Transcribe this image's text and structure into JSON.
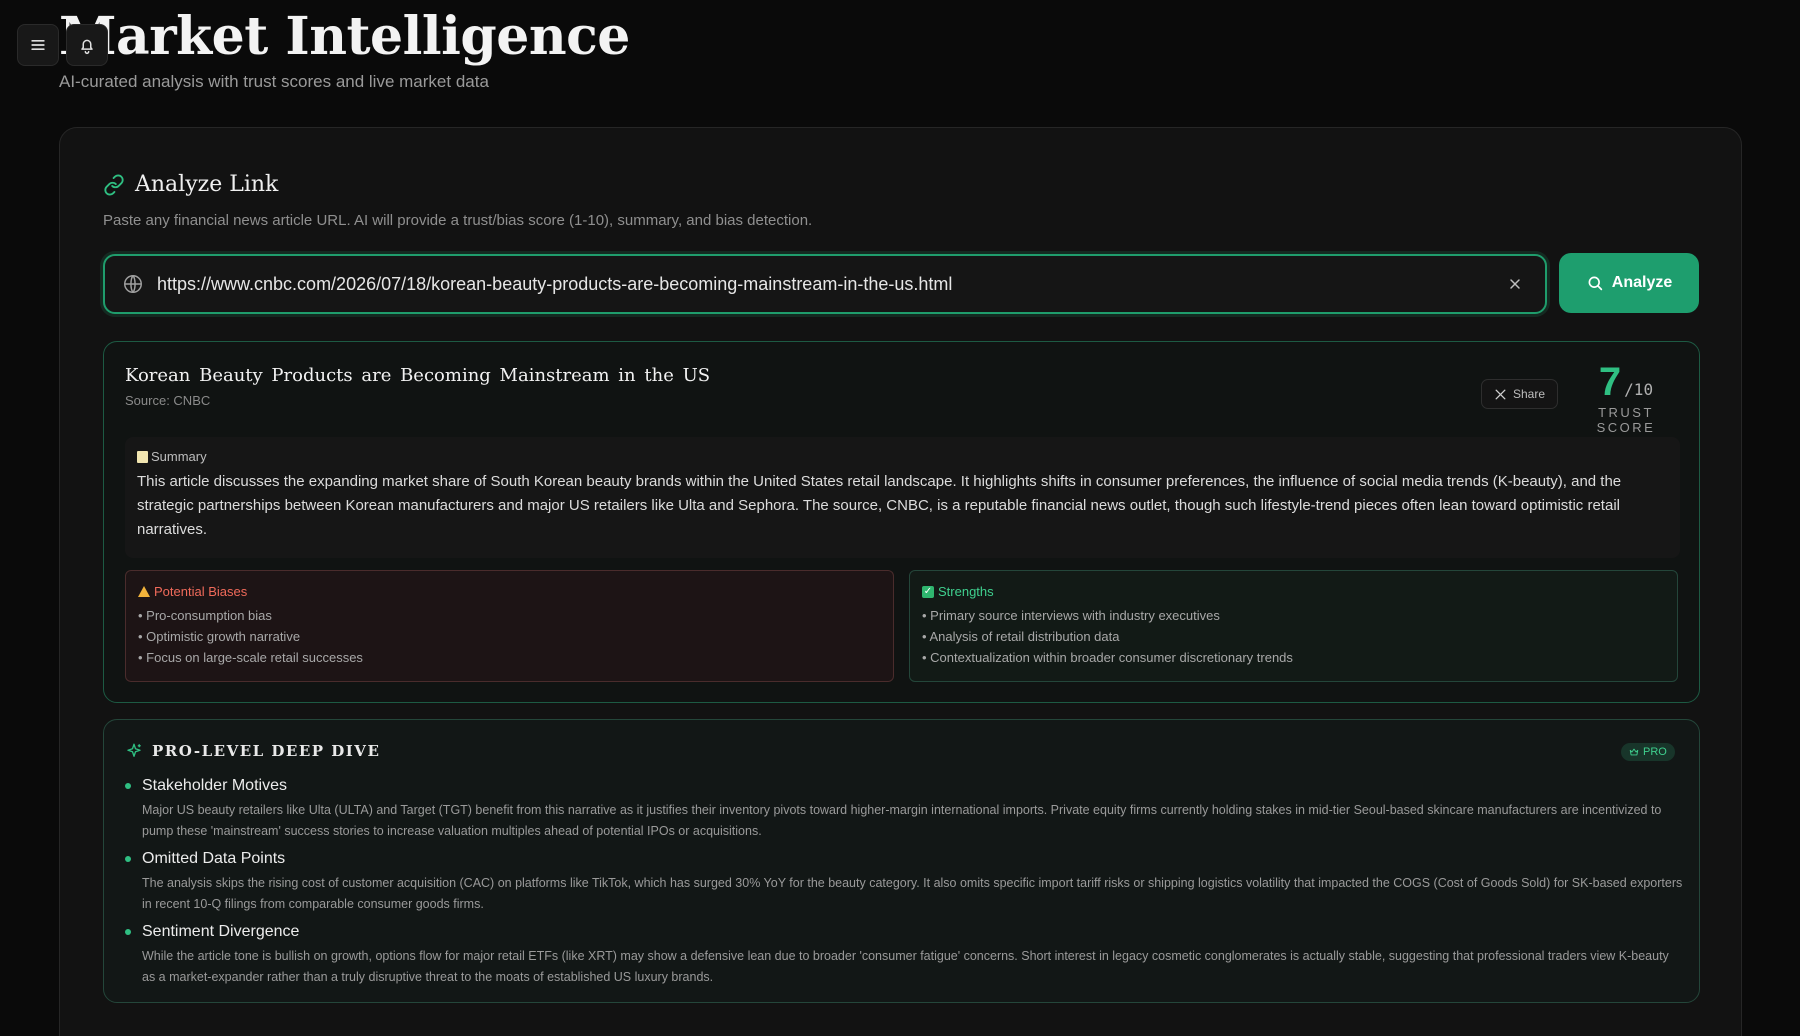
{
  "header": {
    "title": "Market Intelligence",
    "subtitle": "AI-curated analysis with trust scores and live market data"
  },
  "analyze": {
    "title": "Analyze Link",
    "description": "Paste any financial news article URL. AI will provide a trust/bias score (1-10), summary, and bias detection.",
    "url_value": "https://www.cnbc.com/2026/07/18/korean-beauty-products-are-becoming-mainstream-in-the-us.html",
    "button_label": "Analyze"
  },
  "result": {
    "article_title": "Korean Beauty Products are Becoming Mainstream in the US",
    "source": "Source: CNBC",
    "share_label": "Share",
    "score": "7",
    "score_max": "/10",
    "score_label": "TRUST SCORE",
    "summary_label": "Summary",
    "summary_text": "This article discusses the expanding market share of South Korean beauty brands within the United States retail landscape. It highlights shifts in consumer preferences, the influence of social media trends (K-beauty), and the strategic partnerships between Korean manufacturers and major US retailers like Ulta and Sephora. The source, CNBC, is a reputable financial news outlet, though such lifestyle-trend pieces often lean toward optimistic retail narratives.",
    "biases": {
      "label": "Potential Biases",
      "items": [
        "• Pro-consumption bias",
        "• Optimistic growth narrative",
        "• Focus on large-scale retail successes"
      ]
    },
    "strengths": {
      "label": "Strengths",
      "items": [
        "• Primary source interviews with industry executives",
        "• Analysis of retail distribution data",
        "• Contextualization within broader consumer discretionary trends"
      ]
    }
  },
  "deep_dive": {
    "title": "PRO-LEVEL DEEP DIVE",
    "badge": "PRO",
    "items": [
      {
        "title": "Stakeholder Motives",
        "text": "Major US beauty retailers like Ulta (ULTA) and Target (TGT) benefit from this narrative as it justifies their inventory pivots toward higher-margin international imports. Private equity firms currently holding stakes in mid-tier Seoul-based skincare manufacturers are incentivized to pump these 'mainstream' success stories to increase valuation multiples ahead of potential IPOs or acquisitions."
      },
      {
        "title": "Omitted Data Points",
        "text": "The analysis skips the rising cost of customer acquisition (CAC) on platforms like TikTok, which has surged 30% YoY for the beauty category. It also omits specific import tariff risks or shipping logistics volatility that impacted the COGS (Cost of Goods Sold) for SK-based exporters in recent 10-Q filings from comparable consumer goods firms."
      },
      {
        "title": "Sentiment Divergence",
        "text": "While the article tone is bullish on growth, options flow for major retail ETFs (like XRT) may show a defensive lean due to broader 'consumer fatigue' concerns. Short interest in legacy cosmetic conglomerates is actually stable, suggesting that professional traders view K-beauty as a market-expander rather than a truly disruptive threat to the moats of established US luxury brands."
      }
    ]
  },
  "colors": {
    "accent": "#1e9e6e",
    "score": "#2fbf82",
    "bias": "#f06a5a",
    "strength": "#3fcf8e",
    "background": "#0a0a0a"
  }
}
